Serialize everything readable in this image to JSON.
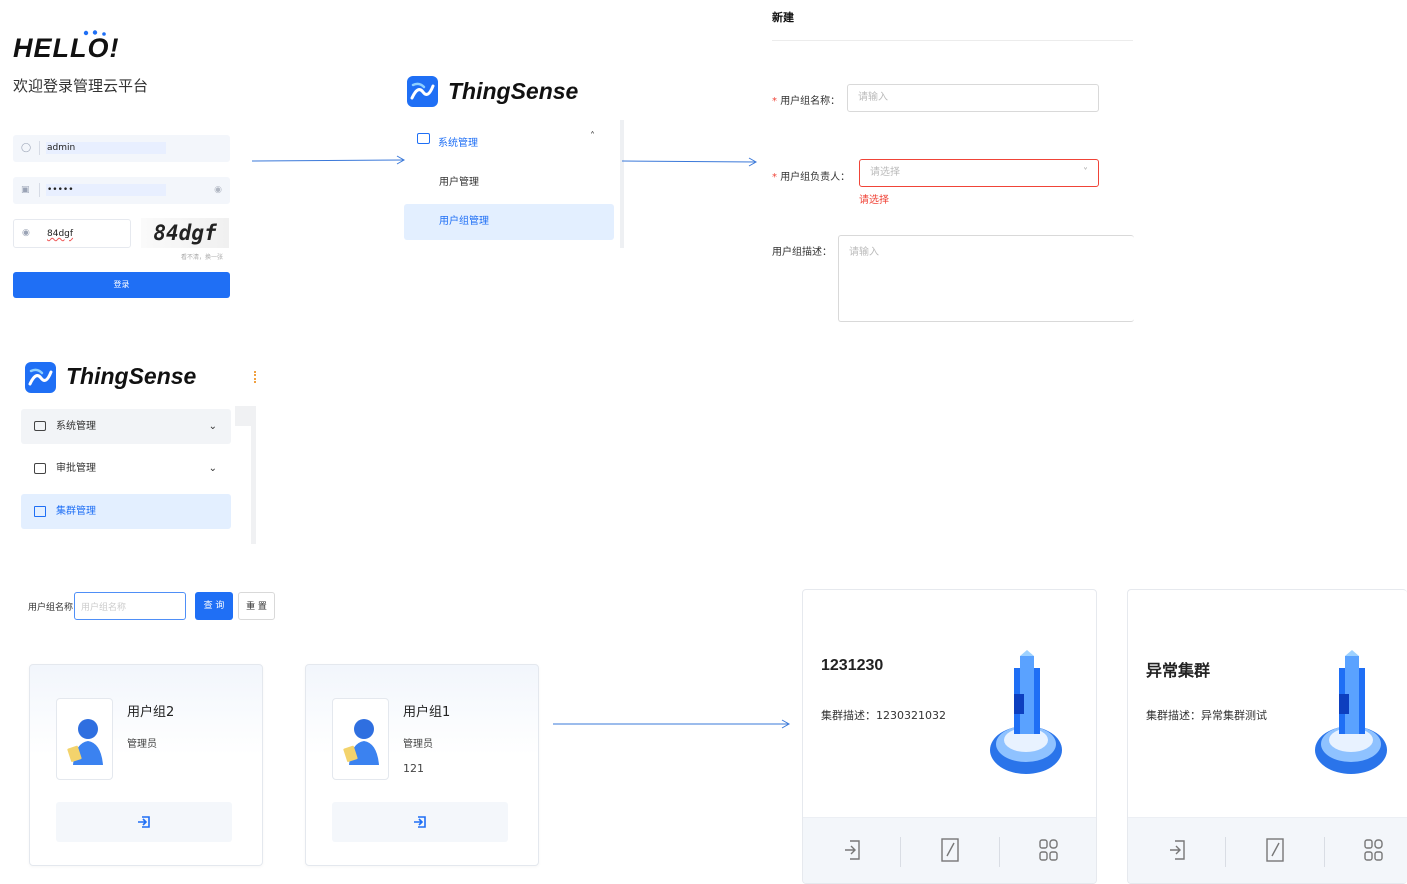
{
  "login": {
    "hello": "HELLO",
    "hello_suffix": "!",
    "welcome": "欢迎登录管理云平台",
    "username": "admin",
    "password": "•••••",
    "captcha_input": "84dgf",
    "captcha_image": "84dgf",
    "refresh_text": "看不清，换一张",
    "login_button": "登录"
  },
  "logo": {
    "name": "ThingSense"
  },
  "menu1": {
    "header": "系统管理",
    "items": [
      {
        "label": "用户管理"
      },
      {
        "label": "用户组管理"
      }
    ]
  },
  "menu2": {
    "items": [
      {
        "label": "系统管理"
      },
      {
        "label": "审批管理"
      },
      {
        "label": "集群管理"
      }
    ]
  },
  "form": {
    "title": "新建",
    "name_label": "用户组名称：",
    "name_placeholder": "请输入",
    "owner_label": "用户组负责人：",
    "owner_placeholder": "请选择",
    "owner_error": "请选择",
    "desc_label": "用户组描述：",
    "desc_placeholder": "请输入",
    "required_mark": "*"
  },
  "search": {
    "label": "用户组名称:",
    "placeholder": "用户组名称",
    "query_button": "查 询",
    "reset_button": "重 置"
  },
  "groups": [
    {
      "name": "用户组2",
      "role": "管理员",
      "extra": ""
    },
    {
      "name": "用户组1",
      "role": "管理员",
      "extra": "121"
    }
  ],
  "clusters": [
    {
      "title": "1231230",
      "desc": "集群描述：1230321032"
    },
    {
      "title": "异常集群",
      "desc": "集群描述：异常集群测试"
    }
  ],
  "colors": {
    "primary": "#1f6ff5",
    "error": "#f04438",
    "active_bg": "#e3efff",
    "arrow": "#3a78d9"
  }
}
